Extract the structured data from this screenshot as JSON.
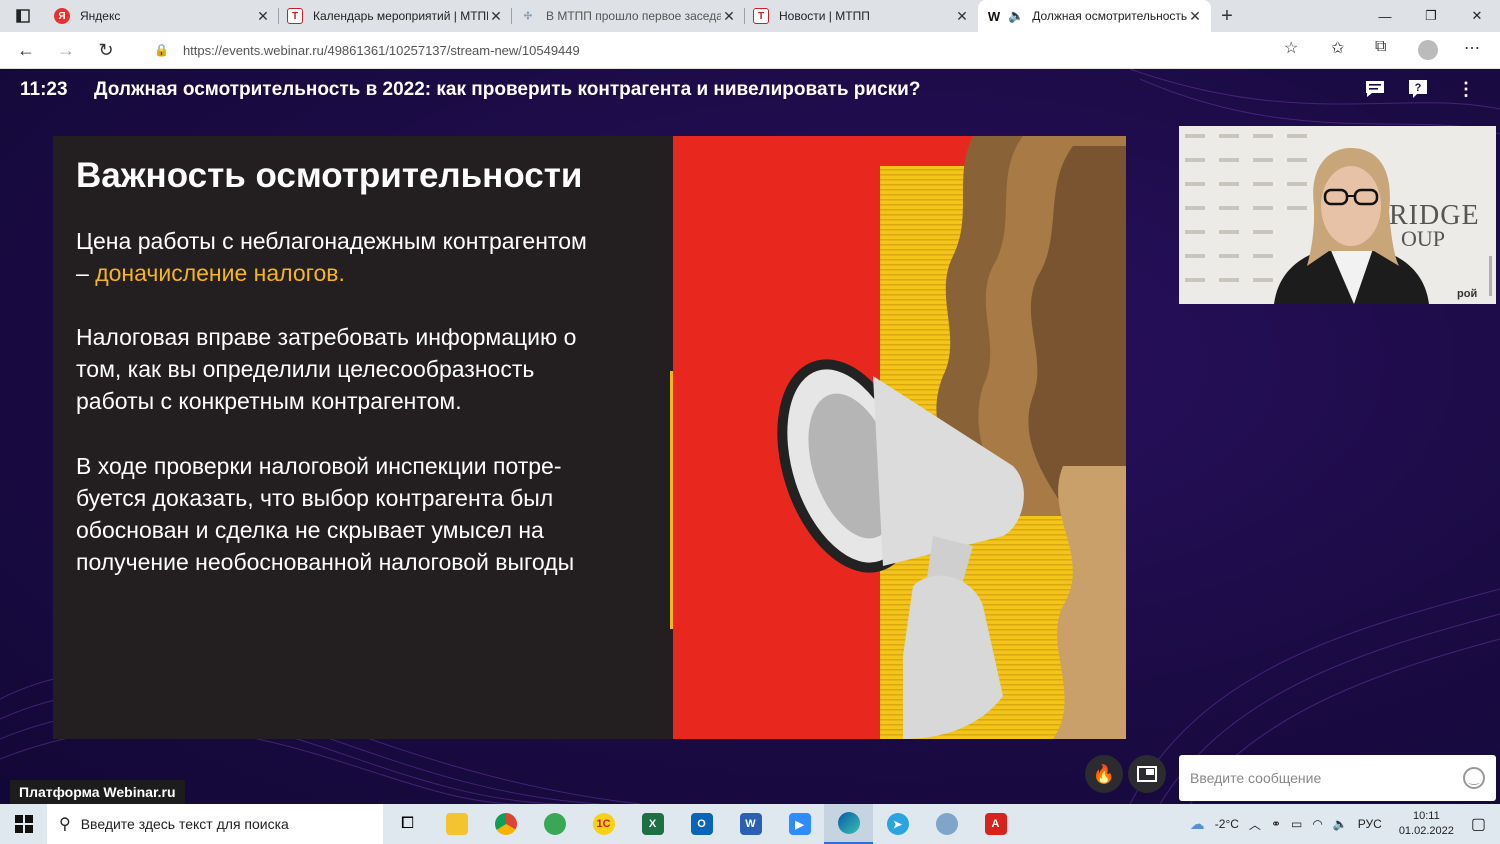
{
  "tabs": [
    {
      "title": "Яндекс",
      "favicon_color": "#e8312f",
      "favicon_glyph": "Я"
    },
    {
      "title": "Календарь мероприятий | МТПП",
      "favicon_color": "#c8202b",
      "favicon_glyph": "Т"
    },
    {
      "title": "В МТПП прошло первое заседание",
      "favicon_color": "#8da0b8",
      "favicon_glyph": "✣"
    },
    {
      "title": "Новости | МТПП",
      "favicon_color": "#c8202b",
      "favicon_glyph": "Т"
    },
    {
      "title": "Должная осмотрительность",
      "favicon_color": "#ffffff",
      "favicon_glyph": "W"
    }
  ],
  "address": {
    "url": "https://events.webinar.ru/49861361/10257137/stream-new/10549449"
  },
  "header": {
    "time": "11:23",
    "title": "Должная осмотрительность в 2022: как проверить контрагента и нивелировать риски?"
  },
  "slide": {
    "heading": "Важность осмотрительности",
    "p1_line1": "Цена работы с неблагонадежным контрагентом",
    "p1_dash": "– ",
    "p1_highlight": "доначисление налогов.",
    "p2_lines": [
      "Налоговая вправе затребовать информацию о",
      "том, как вы определили целесообразность",
      "работы с конкретным контрагентом."
    ],
    "p3_lines": [
      "В ходе проверки налоговой инспекции потре-",
      "буется доказать, что выбор контрагента был",
      "обоснован и сделка не скрывает умысел на",
      "получение необоснованной  налоговой выгоды"
    ],
    "accent_color": "#f5b51c"
  },
  "camera": {
    "backdrop_text_1": "RIDGE",
    "backdrop_text_2": "OUP",
    "backdrop_text_3": "рой"
  },
  "chat": {
    "placeholder": "Введите сообщение"
  },
  "platform_badge": "Платформа Webinar.ru",
  "taskbar": {
    "search_placeholder": "Введите здесь текст для поиска",
    "apps": [
      "task-view",
      "explorer",
      "chrome",
      "maps",
      "1c",
      "excel",
      "outlook",
      "word",
      "zoom",
      "edge",
      "telegram",
      "app",
      "acrobat"
    ],
    "weather": "-2°C",
    "lang": "РУС",
    "time": "10:11",
    "date": "01.02.2022"
  }
}
